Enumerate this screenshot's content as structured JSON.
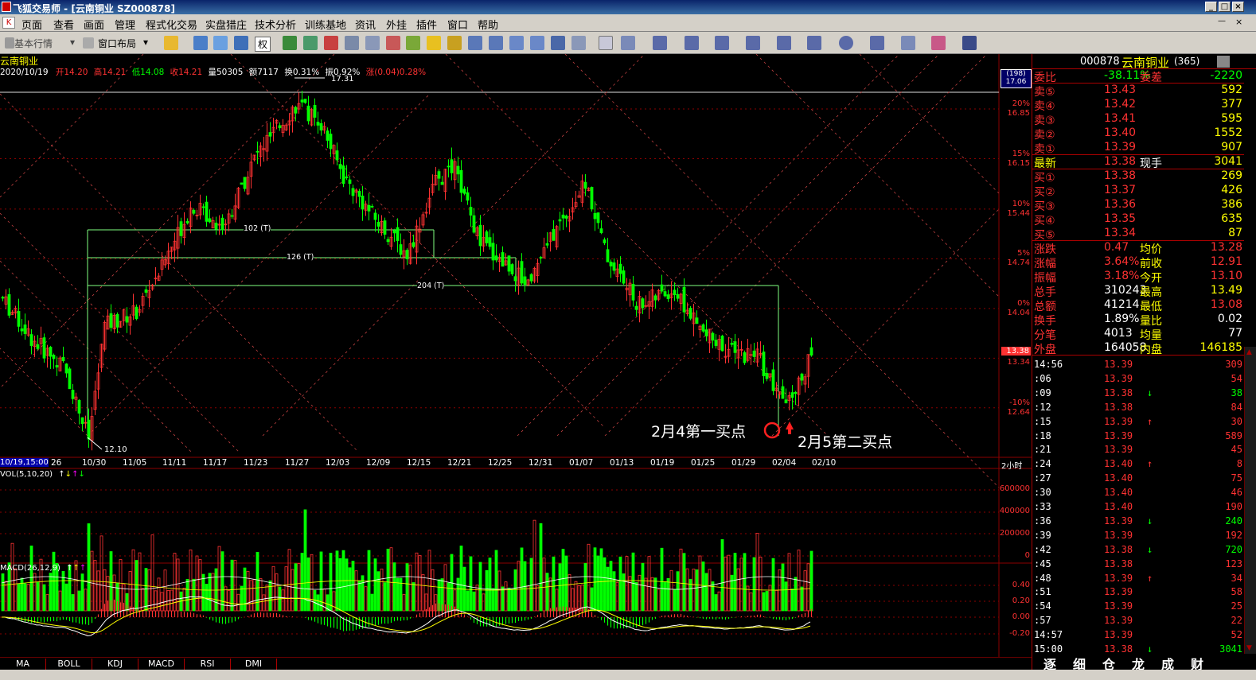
{
  "window": {
    "title": "飞狐交易师 - [云南铜业 SZ000878]"
  },
  "menu": [
    "页面",
    "查看",
    "画面",
    "管理",
    "程式化交易",
    "实盘猎庄",
    "技术分析",
    "训练基地",
    "资讯",
    "外挂",
    "插件",
    "窗口",
    "帮助"
  ],
  "toolbar": {
    "basic_quote": "基本行情",
    "window_layout": "窗口布局",
    "rights_label": "权"
  },
  "chart": {
    "stock_name": "云南铜业",
    "info_date": "2020/10/19",
    "info_open": "开14.20",
    "info_high": "高14.21",
    "info_low": "低14.08",
    "info_close": "收14.21",
    "info_vol": "量50305",
    "info_amt": "额7117",
    "info_turn": "换0.31%",
    "info_amp": "振0.92%",
    "info_chg": "涨(0.04)0.28%",
    "peak_label": "17.31",
    "low_label": "12.10",
    "box_labels": [
      "102 (T)",
      "126 (T)",
      "204 (T)"
    ],
    "annot_buy1": "2月4第一买点",
    "annot_buy2": "2月5第二买点",
    "cursor_date": "10/19,15:00",
    "dates": [
      "26",
      "10/30",
      "11/05",
      "11/11",
      "11/17",
      "11/23",
      "11/27",
      "12/03",
      "12/09",
      "12/15",
      "12/21",
      "12/25",
      "12/31",
      "01/07",
      "01/13",
      "01/19",
      "01/25",
      "01/29",
      "02/04",
      "02/10"
    ],
    "period": "2小时",
    "axis_box_top": "(198)",
    "axis_box_bot": "17.06",
    "price_axis": [
      {
        "pct": "20%",
        "price": "16.85"
      },
      {
        "pct": "15%",
        "price": "16.15"
      },
      {
        "pct": "10%",
        "price": "15.44"
      },
      {
        "pct": "5%",
        "price": "14.74"
      },
      {
        "pct": "0%",
        "price": "14.04"
      },
      {
        "pct": "",
        "price": "13.34"
      },
      {
        "pct": "-10%",
        "price": "12.64"
      }
    ],
    "current_price_tag": "13.38",
    "vol_label": "VOL(5,10,20)",
    "vol_axis": [
      "600000",
      "400000",
      "200000",
      "0"
    ],
    "macd_label": "MACD(26,12,9)",
    "macd_axis": [
      "0.40",
      "0.20",
      "0.00",
      "-0.20"
    ],
    "indicator_tabs": [
      "MA",
      "BOLL",
      "KDJ",
      "MACD",
      "RSI",
      "DMI"
    ]
  },
  "chart_data": {
    "type": "candlestick",
    "title": "云南铜业",
    "x_start": "10/19",
    "x_end": "02/05",
    "price_high": 17.31,
    "price_low": 12.1,
    "box_lines": [
      {
        "label": "102 (T)"
      },
      {
        "label": "126 (T)"
      },
      {
        "label": "204 (T)"
      }
    ]
  },
  "quote": {
    "code": "000878",
    "name": "云南铜业",
    "period": "(365)",
    "weibi_label": "委比",
    "weibi": "-38.11%",
    "weicha_label": "委差",
    "weicha": "-2220",
    "asks": [
      {
        "label": "卖⑤",
        "price": "13.43",
        "vol": "592"
      },
      {
        "label": "卖④",
        "price": "13.42",
        "vol": "377"
      },
      {
        "label": "卖③",
        "price": "13.41",
        "vol": "595"
      },
      {
        "label": "卖②",
        "price": "13.40",
        "vol": "1552"
      },
      {
        "label": "卖①",
        "price": "13.39",
        "vol": "907"
      }
    ],
    "last_label": "最新",
    "last": "13.38",
    "xianshou_label": "现手",
    "xianshou": "3041",
    "bids": [
      {
        "label": "买①",
        "price": "13.38",
        "vol": "269"
      },
      {
        "label": "买②",
        "price": "13.37",
        "vol": "426"
      },
      {
        "label": "买③",
        "price": "13.36",
        "vol": "386"
      },
      {
        "label": "买④",
        "price": "13.35",
        "vol": "635"
      },
      {
        "label": "买⑤",
        "price": "13.34",
        "vol": "87"
      }
    ],
    "stats": [
      {
        "l1": "涨跌",
        "v1": "0.47",
        "l2": "均价",
        "v2": "13.28"
      },
      {
        "l1": "涨幅",
        "v1": "3.64%",
        "l2": "前收",
        "v2": "12.91"
      },
      {
        "l1": "振幅",
        "v1": "3.18%",
        "l2": "今开",
        "v2": "13.10"
      },
      {
        "l1": "总手",
        "v1": "310243",
        "l2": "最高",
        "v2": "13.49"
      },
      {
        "l1": "总额",
        "v1": "41214",
        "l2": "最低",
        "v2": "13.08"
      },
      {
        "l1": "换手",
        "v1": "1.89%",
        "l2": "量比",
        "v2": "0.02"
      },
      {
        "l1": "分笔",
        "v1": "4013",
        "l2": "均量",
        "v2": "77"
      },
      {
        "l1": "外盘",
        "v1": "164058",
        "l2": "内盘",
        "v2": "146185"
      }
    ],
    "ticks": [
      {
        "t": "14:56",
        "p": "13.39",
        "v": "309",
        "a": ""
      },
      {
        "t": ":06",
        "p": "13.39",
        "v": "54",
        "a": ""
      },
      {
        "t": ":09",
        "p": "13.38",
        "v": "38",
        "a": "↓"
      },
      {
        "t": ":12",
        "p": "13.38",
        "v": "84",
        "a": ""
      },
      {
        "t": ":15",
        "p": "13.39",
        "v": "30",
        "a": "↑"
      },
      {
        "t": ":18",
        "p": "13.39",
        "v": "589",
        "a": ""
      },
      {
        "t": ":21",
        "p": "13.39",
        "v": "45",
        "a": ""
      },
      {
        "t": ":24",
        "p": "13.40",
        "v": "8",
        "a": "↑"
      },
      {
        "t": ":27",
        "p": "13.40",
        "v": "75",
        "a": ""
      },
      {
        "t": ":30",
        "p": "13.40",
        "v": "46",
        "a": ""
      },
      {
        "t": ":33",
        "p": "13.40",
        "v": "190",
        "a": ""
      },
      {
        "t": ":36",
        "p": "13.39",
        "v": "240",
        "a": "↓"
      },
      {
        "t": ":39",
        "p": "13.39",
        "v": "192",
        "a": ""
      },
      {
        "t": ":42",
        "p": "13.38",
        "v": "720",
        "a": "↓"
      },
      {
        "t": ":45",
        "p": "13.38",
        "v": "123",
        "a": ""
      },
      {
        "t": ":48",
        "p": "13.39",
        "v": "34",
        "a": "↑"
      },
      {
        "t": ":51",
        "p": "13.39",
        "v": "58",
        "a": ""
      },
      {
        "t": ":54",
        "p": "13.39",
        "v": "25",
        "a": ""
      },
      {
        "t": ":57",
        "p": "13.39",
        "v": "22",
        "a": ""
      },
      {
        "t": "14:57",
        "p": "13.39",
        "v": "52",
        "a": ""
      },
      {
        "t": "15:00",
        "p": "13.38",
        "v": "3041",
        "a": "↓"
      }
    ],
    "tabs": [
      "逐",
      "细",
      "仓",
      "龙",
      "成",
      "财"
    ]
  },
  "colors": {
    "up": "#ff3232",
    "down": "#00ff00",
    "grid": "#8b0000",
    "yellow": "#ffff00"
  }
}
